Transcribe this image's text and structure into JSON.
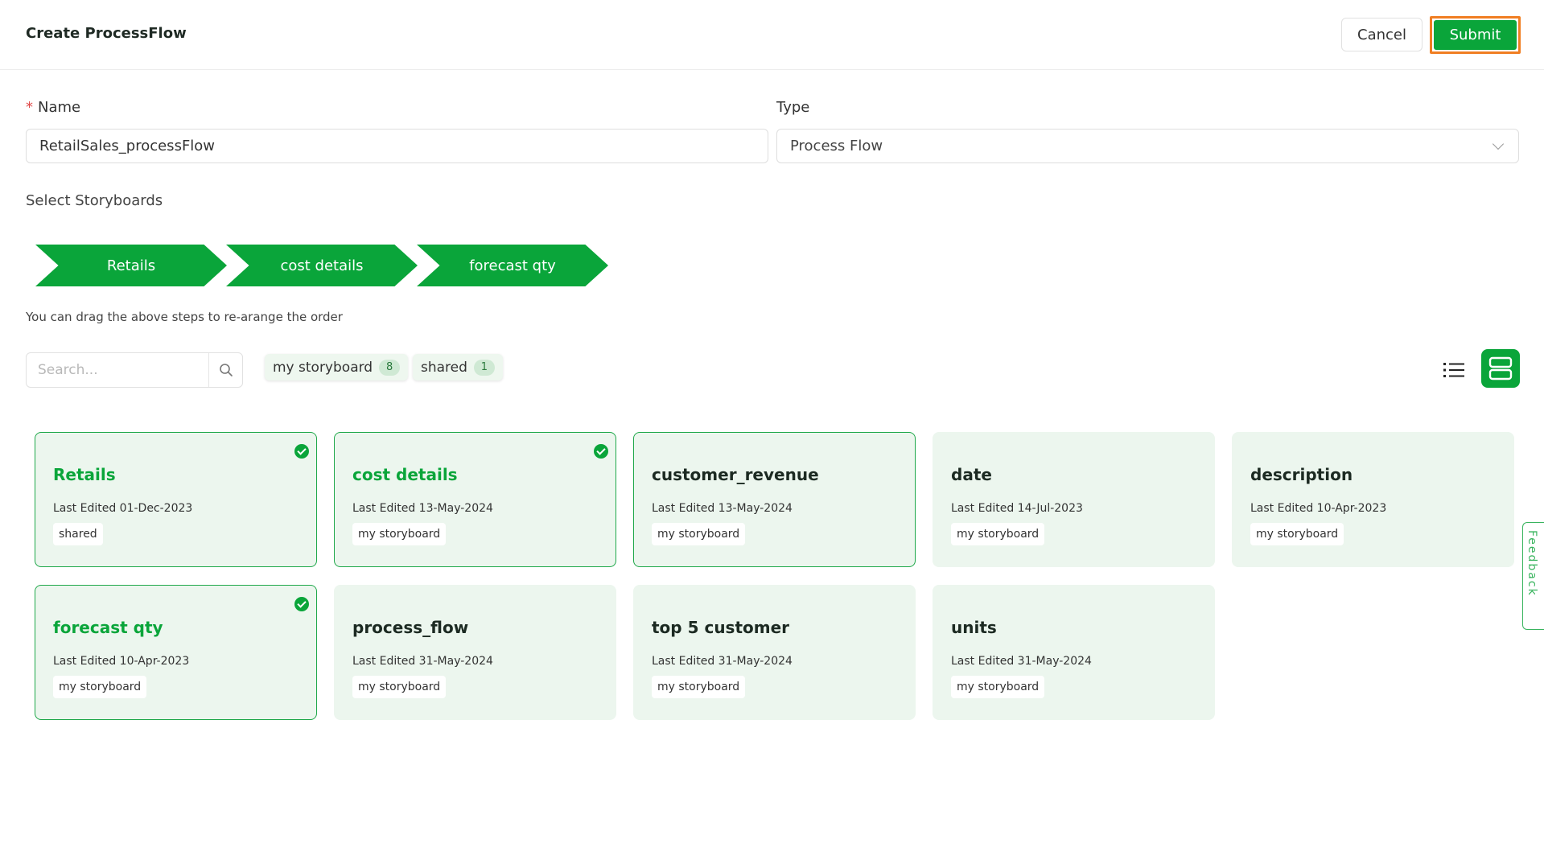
{
  "header": {
    "title": "Create ProcessFlow",
    "cancel_label": "Cancel",
    "submit_label": "Submit"
  },
  "form": {
    "name_label": "Name",
    "name_required_marker": "*",
    "name_value": "RetailSales_processFlow",
    "type_label": "Type",
    "type_value": "Process Flow"
  },
  "storyboards": {
    "section_label": "Select Storyboards",
    "steps": [
      "Retails",
      "cost details",
      "forecast qty"
    ],
    "hint": "You can drag the above steps to re-arange the order"
  },
  "filters": {
    "search_placeholder": "Search...",
    "chips": [
      {
        "label": "my storyboard",
        "count": "8"
      },
      {
        "label": "shared",
        "count": "1"
      }
    ]
  },
  "cards": [
    {
      "title": "Retails",
      "meta": "Last Edited 01-Dec-2023",
      "tag": "shared",
      "selected": true
    },
    {
      "title": "cost details",
      "meta": "Last Edited 13-May-2024",
      "tag": "my storyboard",
      "selected": true
    },
    {
      "title": "customer_revenue",
      "meta": "Last Edited 13-May-2024",
      "tag": "my storyboard",
      "selected": false
    },
    {
      "title": "date",
      "meta": "Last Edited 14-Jul-2023",
      "tag": "my storyboard",
      "selected": false
    },
    {
      "title": "description",
      "meta": "Last Edited 10-Apr-2023",
      "tag": "my storyboard",
      "selected": false
    },
    {
      "title": "forecast qty",
      "meta": "Last Edited 10-Apr-2023",
      "tag": "my storyboard",
      "selected": true
    },
    {
      "title": "process_flow",
      "meta": "Last Edited 31-May-2024",
      "tag": "my storyboard",
      "selected": false
    },
    {
      "title": "top 5 customer",
      "meta": "Last Edited 31-May-2024",
      "tag": "my storyboard",
      "selected": false
    },
    {
      "title": "units",
      "meta": "Last Edited 31-May-2024",
      "tag": "my storyboard",
      "selected": false
    }
  ],
  "feedback": {
    "label": "Feedback"
  },
  "colors": {
    "accent": "#0aa53a",
    "card_bg": "#ecf6ee",
    "highlight": "#f07e22"
  },
  "icons": {
    "search": "search-icon",
    "list_view": "list-view-icon",
    "grid_view": "grid-view-icon",
    "check": "check-circle-icon"
  }
}
